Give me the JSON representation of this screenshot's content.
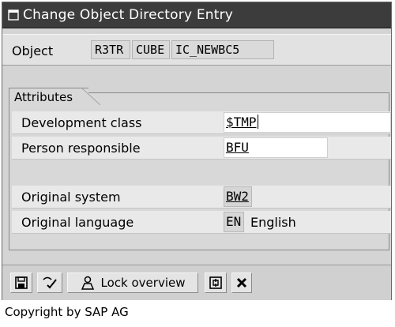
{
  "window": {
    "title": "Change Object Directory Entry"
  },
  "object": {
    "label": "Object",
    "program_id": "R3TR",
    "object_type": "CUBE",
    "object_name": "IC_NEWBC5"
  },
  "attributes": {
    "tab_label": "Attributes",
    "development_class": {
      "label": "Development class",
      "value": "$TMP"
    },
    "person_responsible": {
      "label": "Person responsible",
      "value": "BFU"
    },
    "original_system": {
      "label": "Original system",
      "value": "BW2"
    },
    "original_language": {
      "label": "Original language",
      "code": "EN",
      "name": "English"
    }
  },
  "toolbar": {
    "save_icon": "save-icon",
    "check_icon": "check-icon",
    "lock_overview_icon": "user-lock-icon",
    "lock_overview_label": "Lock overview",
    "other_icon": "display-change-icon",
    "cancel_icon": "cancel-icon"
  },
  "footer": {
    "copyright": "Copyright by SAP AG"
  }
}
